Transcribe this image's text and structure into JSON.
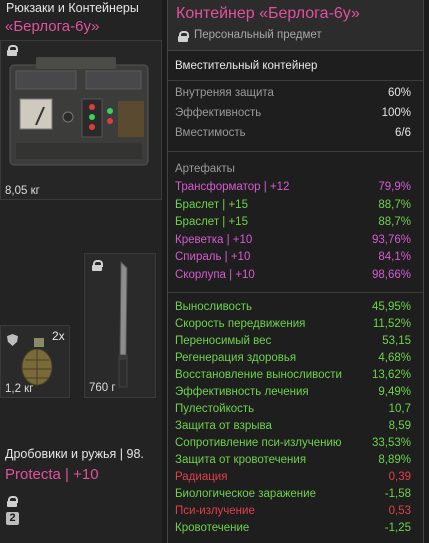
{
  "inventory": {
    "category": "Рюкзаки и Контейнеры",
    "container_name": "«Берлога-6у»",
    "container_weight": "8,05 кг",
    "grenade_weight": "1,2 кг",
    "grenade_count": "2x",
    "knife_weight": "760 г",
    "category2": "Дробовики и ружья | 98.",
    "weapon_name": "Protecta  | +10",
    "badge_number": "2"
  },
  "tooltip": {
    "title": "Контейнер «Берлога-6у»",
    "subtitle": "Персональный предмет",
    "description": "Вместительный контейнер",
    "base_stats": [
      {
        "label": "Внутреняя защита",
        "value": "60%"
      },
      {
        "label": "Эффективность",
        "value": "100%"
      },
      {
        "label": "Вместимость",
        "value": "6/6"
      }
    ],
    "artifacts_header": "Артефакты",
    "artifacts": [
      {
        "label": "Трансформатор | +12",
        "value": "79,9%",
        "color": "pink"
      },
      {
        "label": "Браслет | +15",
        "value": "88,7%",
        "color": "green"
      },
      {
        "label": "Браслет | +15",
        "value": "88,7%",
        "color": "green"
      },
      {
        "label": "Креветка | +10",
        "value": "93,76%",
        "color": "pink"
      },
      {
        "label": "Спираль | +10",
        "value": "84,1%",
        "color": "pink"
      },
      {
        "label": "Скорлупа | +10",
        "value": "98,66%",
        "color": "pink"
      }
    ],
    "effects": [
      {
        "label": "Выносливость",
        "value": "45,95%",
        "color": "green"
      },
      {
        "label": "Скорость передвижения",
        "value": "11,52%",
        "color": "green"
      },
      {
        "label": "Переносимый вес",
        "value": "53,15",
        "color": "green"
      },
      {
        "label": "Регенерация здоровья",
        "value": "4,68%",
        "color": "green"
      },
      {
        "label": "Восстановление выносливости",
        "value": "13,62%",
        "color": "green"
      },
      {
        "label": "Эффективность лечения",
        "value": "9,49%",
        "color": "green"
      },
      {
        "label": "Пулестойкость",
        "value": "10,7",
        "color": "green"
      },
      {
        "label": "Защита от взрыва",
        "value": "8,59",
        "color": "green"
      },
      {
        "label": "Сопротивление пси-излучению",
        "value": "33,53%",
        "color": "green"
      },
      {
        "label": "Защита от кровотечения",
        "value": "8,89%",
        "color": "green"
      },
      {
        "label": "Радиация",
        "value": "0,39",
        "color": "red"
      },
      {
        "label": "Биологическое заражение",
        "value": "-1,58",
        "color": "green"
      },
      {
        "label": "Пси-излучение",
        "value": "0,53",
        "color": "red"
      },
      {
        "label": "Кровотечение",
        "value": "-1,25",
        "color": "green"
      }
    ]
  },
  "colors": {
    "accent_pink": "#e0529b",
    "artifact_pink": "#d65bd1",
    "positive_green": "#6fd24d",
    "negative_red": "#e0404a"
  }
}
